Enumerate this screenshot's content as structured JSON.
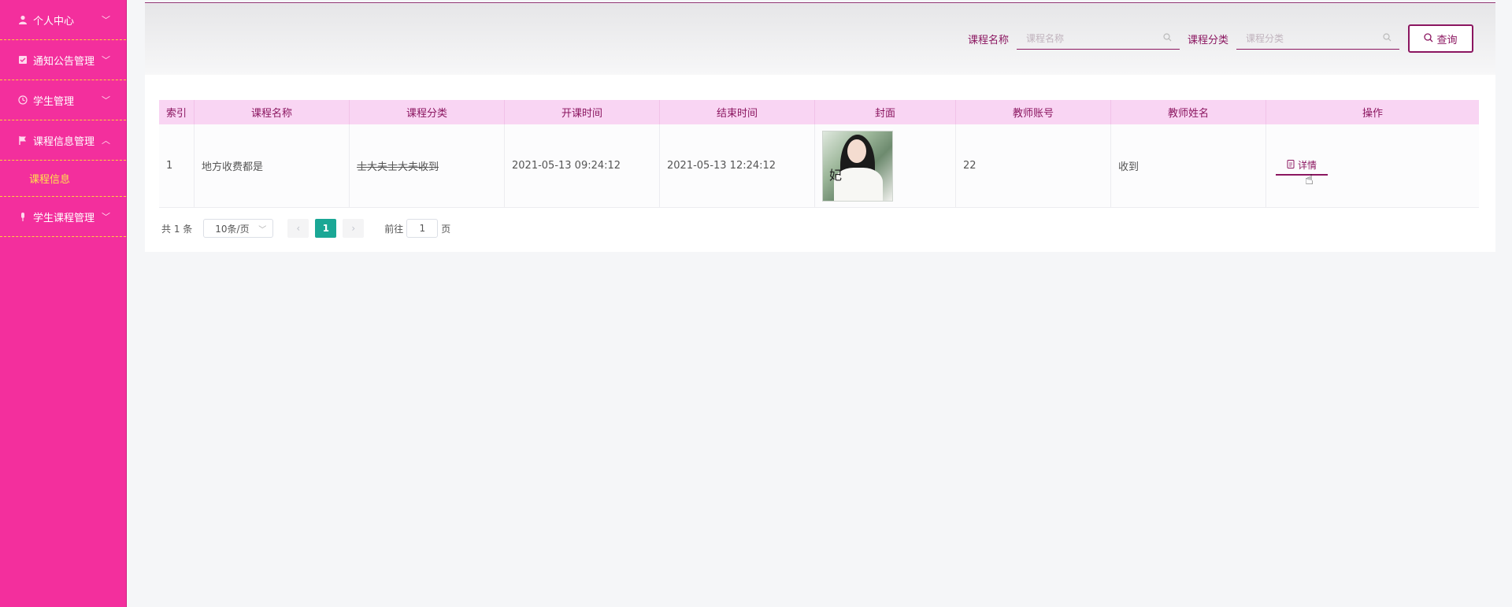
{
  "sidebar": {
    "items": [
      {
        "label": "个人中心",
        "icon": "user-icon"
      },
      {
        "label": "通知公告管理",
        "icon": "notice-icon"
      },
      {
        "label": "学生管理",
        "icon": "clock-icon"
      },
      {
        "label": "课程信息管理",
        "icon": "flag-icon"
      },
      {
        "label": "学生课程管理",
        "icon": "pin-icon"
      }
    ],
    "submenu_label": "课程信息",
    "colors": {
      "background": "#f32f9d",
      "divider": "#ffd23a",
      "active_text": "#ffe14d"
    }
  },
  "search": {
    "course_name_label": "课程名称",
    "course_name_placeholder": "课程名称",
    "course_category_label": "课程分类",
    "course_category_placeholder": "课程分类",
    "query_label": "查询"
  },
  "table": {
    "headers": [
      "索引",
      "课程名称",
      "课程分类",
      "开课时间",
      "结束时间",
      "封面",
      "教师账号",
      "教师姓名",
      "操作"
    ],
    "rows": [
      {
        "index": "1",
        "course_name": "地方收费都是",
        "course_category": "士大夫士大夫收到",
        "start_time": "2021-05-13 09:24:12",
        "end_time": "2021-05-13 12:24:12",
        "cover_text": "妃",
        "teacher_account": "22",
        "teacher_name": "收到",
        "action_label": "详情"
      }
    ]
  },
  "pagination": {
    "total_text": "共 1 条",
    "page_size": "10条/页",
    "current_page": "1",
    "goto_prefix": "前往",
    "goto_value": "1",
    "goto_suffix": "页"
  },
  "theme": {
    "accent": "#8b1660",
    "header_bg": "#f9d5f3",
    "page_active": "#1aa795"
  }
}
